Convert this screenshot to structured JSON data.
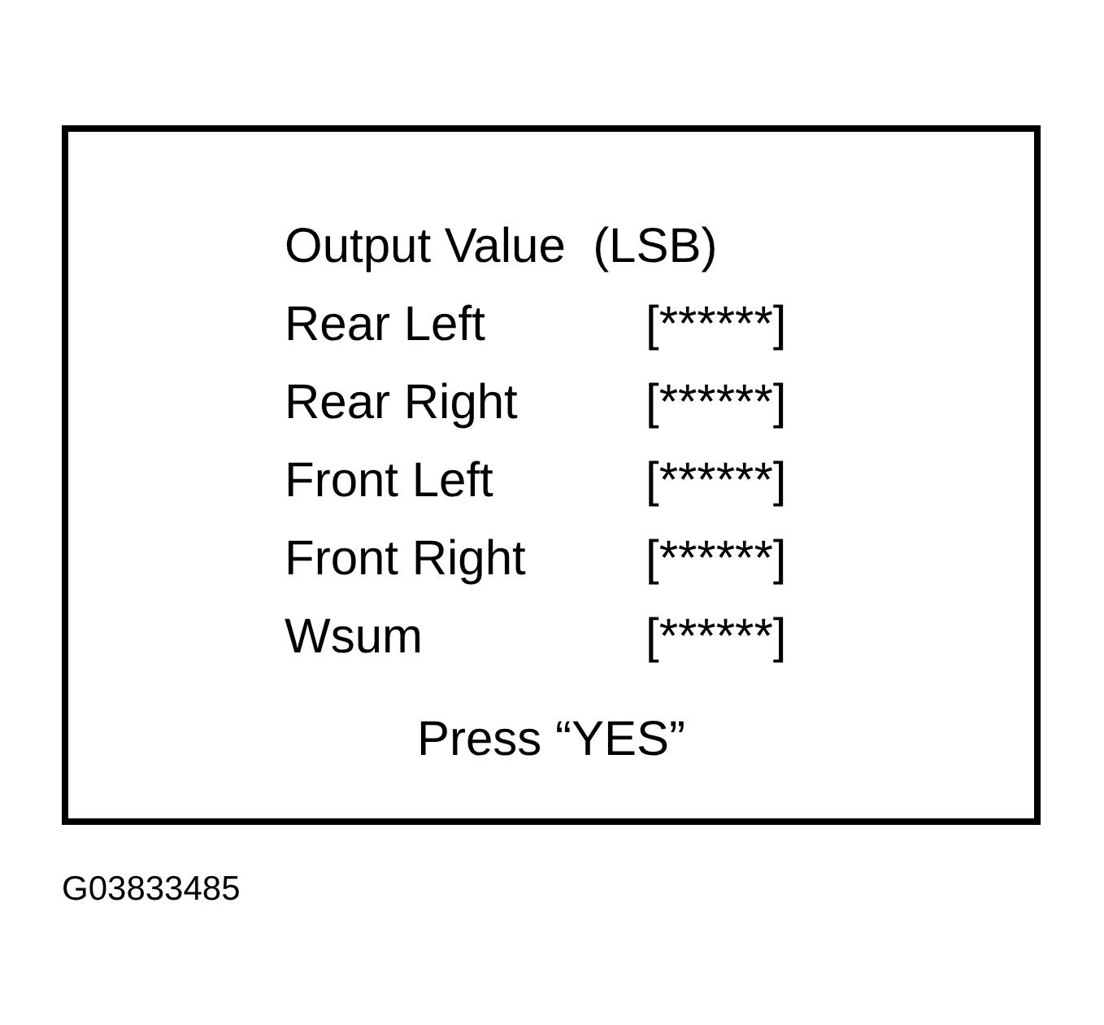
{
  "screen": {
    "heading": "Output Value  (LSB)",
    "rows": [
      {
        "label": "Rear Left",
        "value": "[******]"
      },
      {
        "label": "Rear Right",
        "value": "[******]"
      },
      {
        "label": "Front Left",
        "value": "[******]"
      },
      {
        "label": "Front Right",
        "value": "[******]"
      },
      {
        "label": "Wsum",
        "value": "[******]"
      }
    ],
    "prompt": "Press “YES”"
  },
  "figure_id": "G03833485"
}
